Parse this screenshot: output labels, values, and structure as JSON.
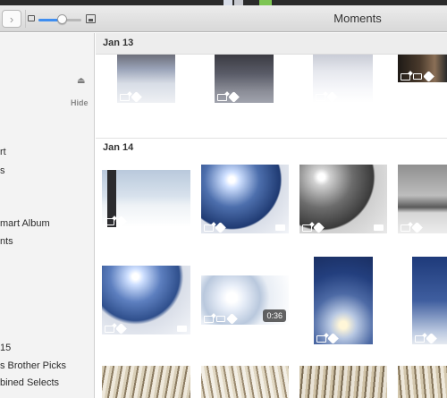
{
  "window": {
    "title": "Moments"
  },
  "toolbar": {
    "forward_glyph": "›",
    "zoom_value": 0.55,
    "accent": "#3f8ef0"
  },
  "sidebar": {
    "eject_glyph": "⏏",
    "hide_label": "Hide",
    "items": [
      {
        "label": "rt"
      },
      {
        "label": "s"
      },
      {
        "label": "mart Album"
      },
      {
        "label": "nts"
      },
      {
        "label": "15"
      },
      {
        "label": "s Brother Picks"
      },
      {
        "label": "bined Selects"
      }
    ]
  },
  "moments": [
    {
      "label": "Jan 13"
    },
    {
      "label": "Jan 14"
    }
  ],
  "videos": [
    {
      "duration": "0:36"
    }
  ]
}
